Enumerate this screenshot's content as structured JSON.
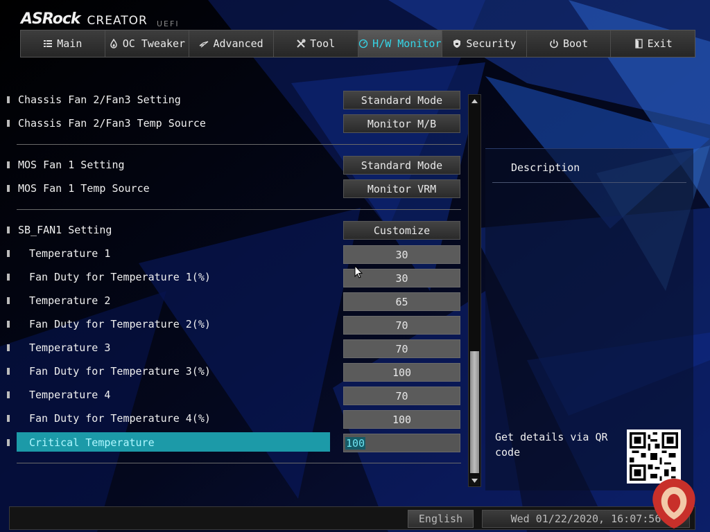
{
  "header": {
    "brand": "ASRock",
    "product": "CREATOR",
    "subtitle": "UEFI"
  },
  "tabs": [
    {
      "label": "Main",
      "icon": "list-icon",
      "active": false
    },
    {
      "label": "OC Tweaker",
      "icon": "flame-icon",
      "active": false
    },
    {
      "label": "Advanced",
      "icon": "star-icon",
      "active": false
    },
    {
      "label": "Tool",
      "icon": "tools-icon",
      "active": false
    },
    {
      "label": "H/W Monitor",
      "icon": "monitor-icon",
      "active": true
    },
    {
      "label": "Security",
      "icon": "shield-icon",
      "active": false
    },
    {
      "label": "Boot",
      "icon": "power-icon",
      "active": false
    },
    {
      "label": "Exit",
      "icon": "exit-icon",
      "active": false
    }
  ],
  "settings": [
    {
      "label": "Chassis Fan 2/Fan3 Setting",
      "value": "Standard Mode"
    },
    {
      "label": "Chassis Fan 2/Fan3 Temp Source",
      "value": "Monitor M/B"
    },
    {
      "label": "MOS Fan 1 Setting",
      "value": "Standard Mode"
    },
    {
      "label": "MOS Fan 1 Temp Source",
      "value": "Monitor VRM"
    },
    {
      "label": "SB_FAN1 Setting",
      "value": "Customize"
    },
    {
      "label": "Temperature 1",
      "value": "30"
    },
    {
      "label": "Fan Duty for Temperature 1(%)",
      "value": "30"
    },
    {
      "label": "Temperature 2",
      "value": "65"
    },
    {
      "label": "Fan Duty for Temperature 2(%)",
      "value": "70"
    },
    {
      "label": "Temperature 3",
      "value": "70"
    },
    {
      "label": "Fan Duty for Temperature 3(%)",
      "value": "100"
    },
    {
      "label": "Temperature 4",
      "value": "70"
    },
    {
      "label": "Fan Duty for Temperature 4(%)",
      "value": "100"
    },
    {
      "label": "Critical Temperature",
      "value": "100"
    }
  ],
  "description": {
    "title": "Description",
    "qr_text": "Get details via QR code"
  },
  "footer": {
    "language": "English",
    "datetime": "Wed 01/22/2020, 16:07:56"
  },
  "colors": {
    "accent": "#35d6e8",
    "selection": "#1c9aa8"
  }
}
